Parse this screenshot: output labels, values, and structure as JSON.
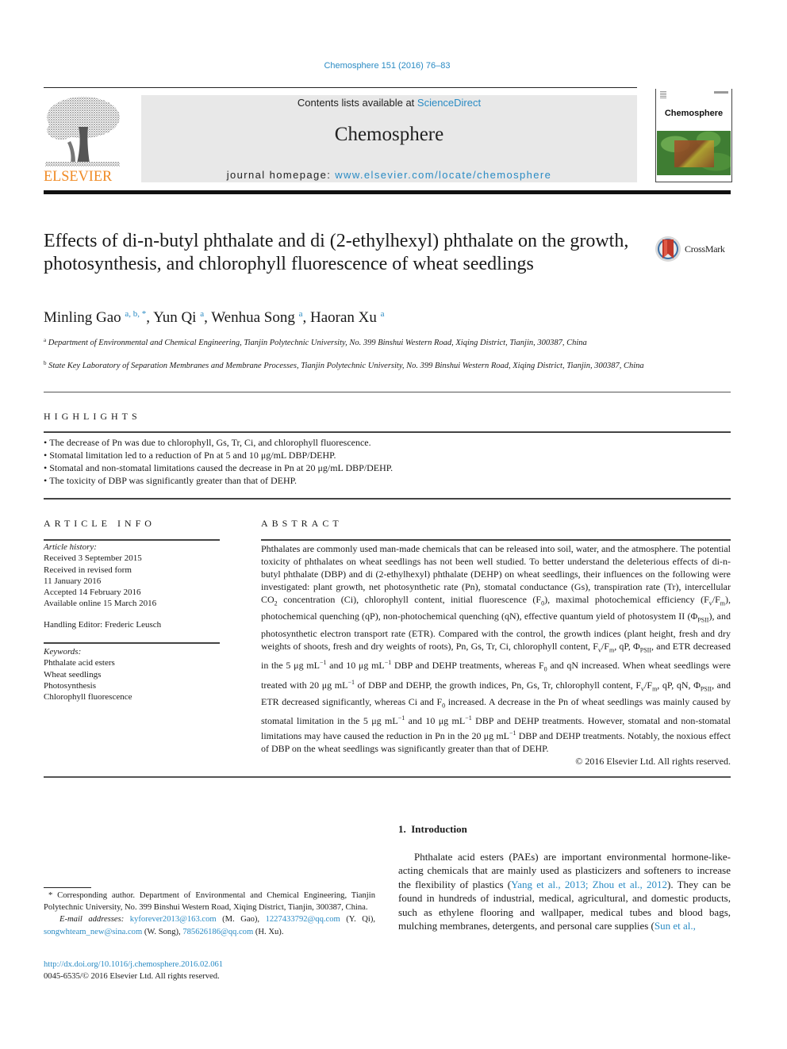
{
  "header": {
    "citation": "Chemosphere 151 (2016) 76–83",
    "publisher_logo_text": "ELSEVIER",
    "contents_prefix": "Contents lists available at ",
    "contents_link": "ScienceDirect",
    "journal_name": "Chemosphere",
    "homepage_prefix": "journal homepage: ",
    "homepage_link": "www.elsevier.com/locate/chemosphere",
    "cover_title": "Chemosphere"
  },
  "article": {
    "title": "Effects of di-n-butyl phthalate and di (2-ethylhexyl) phthalate on the growth, photosynthesis, and chlorophyll fluorescence of wheat seedlings",
    "crossmark_label": "CrossMark",
    "authors": [
      {
        "name": "Minling Gao",
        "sup": "a, b, *",
        "sep": ", "
      },
      {
        "name": "Yun Qi",
        "sup": "a",
        "sep": ", "
      },
      {
        "name": "Wenhua Song",
        "sup": "a",
        "sep": ", "
      },
      {
        "name": "Haoran Xu",
        "sup": "a",
        "sep": ""
      }
    ],
    "affiliations": [
      {
        "mark": "a",
        "text": "Department of Environmental and Chemical Engineering, Tianjin Polytechnic University, No. 399 Binshui Western Road, Xiqing District, Tianjin, 300387, China"
      },
      {
        "mark": "b",
        "text": "State Key Laboratory of Separation Membranes and Membrane Processes, Tianjin Polytechnic University, No. 399 Binshui Western Road, Xiqing District, Tianjin, 300387, China"
      }
    ]
  },
  "highlights": {
    "heading": "HIGHLIGHTS",
    "items": [
      "The decrease of Pn was due to chlorophyll, Gs, Tr, Ci, and chlorophyll fluorescence.",
      "Stomatal limitation led to a reduction of Pn at 5 and 10 μg/mL DBP/DEHP.",
      "Stomatal and non-stomatal limitations caused the decrease in Pn at 20 μg/mL DBP/DEHP.",
      "The toxicity of DBP was significantly greater than that of DEHP."
    ]
  },
  "article_info": {
    "heading": "ARTICLE INFO",
    "history_label": "Article history:",
    "history": [
      "Received 3 September 2015",
      "Received in revised form",
      "11 January 2016",
      "Accepted 14 February 2016",
      "Available online 15 March 2016"
    ],
    "handling_editor": "Handling Editor: Frederic Leusch",
    "keywords_label": "Keywords:",
    "keywords": [
      "Phthalate acid esters",
      "Wheat seedlings",
      "Photosynthesis",
      "Chlorophyll fluorescence"
    ]
  },
  "abstract": {
    "heading": "ABSTRACT",
    "p1": "Phthalates are commonly used man-made chemicals that can be released into soil, water, and the atmosphere. The potential toxicity of phthalates on wheat seedlings has not been well studied. To better understand the deleterious effects of di-n-butyl phthalate (DBP) and di (2-ethylhexyl) phthalate (DEHP) on wheat seedlings, their influences on the following were investigated: plant growth, net photosynthetic rate (Pn), stomatal conductance (Gs), transpiration rate (Tr), intercellular CO",
    "p2": " concentration (Ci), chlorophyll content, initial fluorescence (F",
    "p3": "), maximal photochemical efficiency (F",
    "p4": "), photochemical quenching (qP), non-photochemical quenching (qN), effective quantum yield of photosystem II (Φ",
    "p5": "), and photosynthetic electron transport rate (ETR). Compared with the control, the growth indices (plant height, fresh and dry weights of shoots, fresh and dry weights of roots), Pn, Gs, Tr, Ci, chlorophyll content, F",
    "p6": ", qP, Φ",
    "p7": ", and ETR decreased in the 5 μg mL",
    "p8": " and 10 μg mL",
    "p9": " DBP and DEHP treatments, whereas F",
    "p10": " and qN increased. When wheat seedlings were treated with 20 μg mL",
    "p11": " of DBP and DEHP, the growth indices, Pn, Gs, Tr, chlorophyll content, F",
    "p12": ", qP, qN, Φ",
    "p13": ", and ETR decreased significantly, whereas Ci and F",
    "p14": " increased. A decrease in the Pn of wheat seedlings was mainly caused by stomatal limitation in the 5 μg mL",
    "p15": " and 10 μg mL",
    "p16": " DBP and DEHP treatments. However, stomatal and non-stomatal limitations may have caused the reduction in Pn in the 20 μg mL",
    "p17": " DBP and DEHP treatments. Notably, the noxious effect of DBP on the wheat seedlings was significantly greater than that of DEHP.",
    "sub_2": "2",
    "sub_0": "0",
    "sub_v": "v",
    "sub_m": "m",
    "sub_psii": "PSII",
    "sup_neg1": "−1",
    "slash": "/F",
    "copyright": "© 2016 Elsevier Ltd. All rights reserved."
  },
  "introduction": {
    "heading": "1.  Introduction",
    "text_before": "Phthalate acid esters (PAEs) are important environmental hormone-like-acting chemicals that are mainly used as plasticizers and softeners to increase the flexibility of plastics (",
    "ref1": "Yang et al., 2013; Zhou et al., 2012",
    "text_mid": "). They can be found in hundreds of industrial, medical, agricultural, and domestic products, such as ethylene flooring and wallpaper, medical tubes and blood bags, mulching membranes, detergents, and personal care supplies (",
    "ref2": "Sun et al.,"
  },
  "footnotes": {
    "corresponding": "* Corresponding author. Department of Environmental and Chemical Engineering, Tianjin Polytechnic University, No. 399 Binshui Western Road, Xiqing District, Tianjin, 300387, China.",
    "email_label": "E-mail addresses:",
    "emails": [
      {
        "email": "kyforever2013@163.com",
        "who": " (M. Gao), "
      },
      {
        "email": "1227433792@qq.com",
        "who": " (Y. Qi), "
      },
      {
        "email": "songwhteam_new@sina.com",
        "who": " (W. Song), "
      },
      {
        "email": "785626186@qq.com",
        "who": " (H. Xu)."
      }
    ],
    "doi": "http://dx.doi.org/10.1016/j.chemosphere.2016.02.061",
    "issn": "0045-6535/© 2016 Elsevier Ltd. All rights reserved."
  },
  "colors": {
    "link": "#2a8bc4",
    "elsevier_orange": "#f08a24",
    "header_gray": "#e8e8e8",
    "crossmark_red": "#c0392b"
  }
}
